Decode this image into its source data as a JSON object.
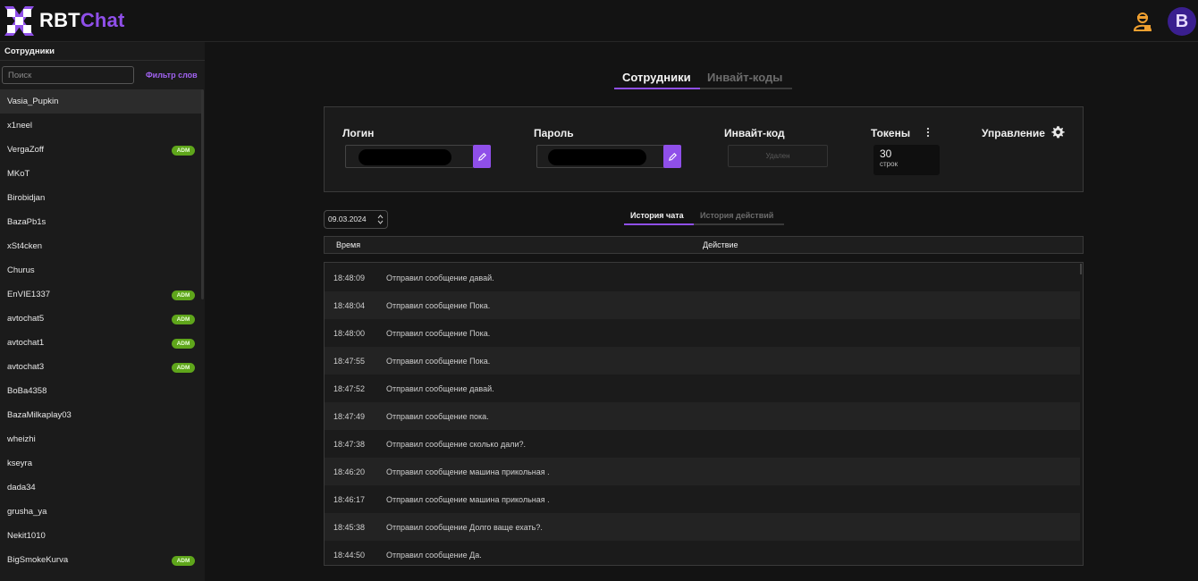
{
  "app": {
    "name_part1": "RBT",
    "name_part2": "Chat",
    "user_initial": "B"
  },
  "colors": {
    "accent": "#8f4fe9",
    "badge": "#5fa61b",
    "agent_icon": "#f0a030"
  },
  "icons": [
    "logo-icon",
    "agent-icon",
    "pencil-icon",
    "kebab-menu-icon",
    "gear-icon",
    "spinner-arrows-icon"
  ],
  "sidebar": {
    "title": "Сотрудники",
    "search_placeholder": "Поиск",
    "filter_label": "Фильтр слов",
    "items": [
      {
        "name": "Vasia_Pupkin",
        "badge": "",
        "active": true
      },
      {
        "name": "x1neel",
        "badge": ""
      },
      {
        "name": "VergaZoff",
        "badge": "ADM"
      },
      {
        "name": "MKoT",
        "badge": ""
      },
      {
        "name": "Birobidjan",
        "badge": ""
      },
      {
        "name": "BazaPb1s",
        "badge": ""
      },
      {
        "name": "xSt4cken",
        "badge": ""
      },
      {
        "name": "Churus",
        "badge": ""
      },
      {
        "name": "EnVIE1337",
        "badge": "ADM"
      },
      {
        "name": "avtochat5",
        "badge": "ADM"
      },
      {
        "name": "avtochat1",
        "badge": "ADM"
      },
      {
        "name": "avtochat3",
        "badge": "ADM"
      },
      {
        "name": "BoBa4358",
        "badge": ""
      },
      {
        "name": "BazaMilkaplay03",
        "badge": ""
      },
      {
        "name": "wheizhi",
        "badge": ""
      },
      {
        "name": "kseyra",
        "badge": ""
      },
      {
        "name": "dada34",
        "badge": ""
      },
      {
        "name": "grusha_ya",
        "badge": ""
      },
      {
        "name": "Nekit1010",
        "badge": ""
      },
      {
        "name": "BigSmokeKurva",
        "badge": "ADM"
      }
    ]
  },
  "main": {
    "tabs": [
      {
        "label": "Сотрудники",
        "active": true
      },
      {
        "label": "Инвайт-коды",
        "active": false
      }
    ],
    "card": {
      "login_label": "Логин",
      "password_label": "Пароль",
      "invite_label": "Инвайт-код",
      "invite_value": "Удален",
      "tokens_label": "Токены",
      "tokens_value": "30",
      "tokens_unit": "строк",
      "manage_label": "Управление"
    },
    "date": "09.03.2024",
    "subtabs": [
      {
        "label": "История чата",
        "active": true
      },
      {
        "label": "История действий",
        "active": false
      }
    ],
    "table": {
      "headers": [
        "Время",
        "Действие"
      ],
      "rows": [
        {
          "time": "18:48:09",
          "action": "Отправил сообщение давай."
        },
        {
          "time": "18:48:04",
          "action": "Отправил сообщение Пока."
        },
        {
          "time": "18:48:00",
          "action": "Отправил сообщение Пока."
        },
        {
          "time": "18:47:55",
          "action": "Отправил сообщение Пока."
        },
        {
          "time": "18:47:52",
          "action": "Отправил сообщение давай."
        },
        {
          "time": "18:47:49",
          "action": "Отправил сообщение пока."
        },
        {
          "time": "18:47:38",
          "action": "Отправил сообщение сколько дали?."
        },
        {
          "time": "18:46:20",
          "action": "Отправил сообщение машина прикольная ."
        },
        {
          "time": "18:46:17",
          "action": "Отправил сообщение машина прикольная ."
        },
        {
          "time": "18:45:38",
          "action": "Отправил сообщение Долго ваще ехать?."
        },
        {
          "time": "18:44:50",
          "action": "Отправил сообщение Да."
        }
      ]
    }
  }
}
